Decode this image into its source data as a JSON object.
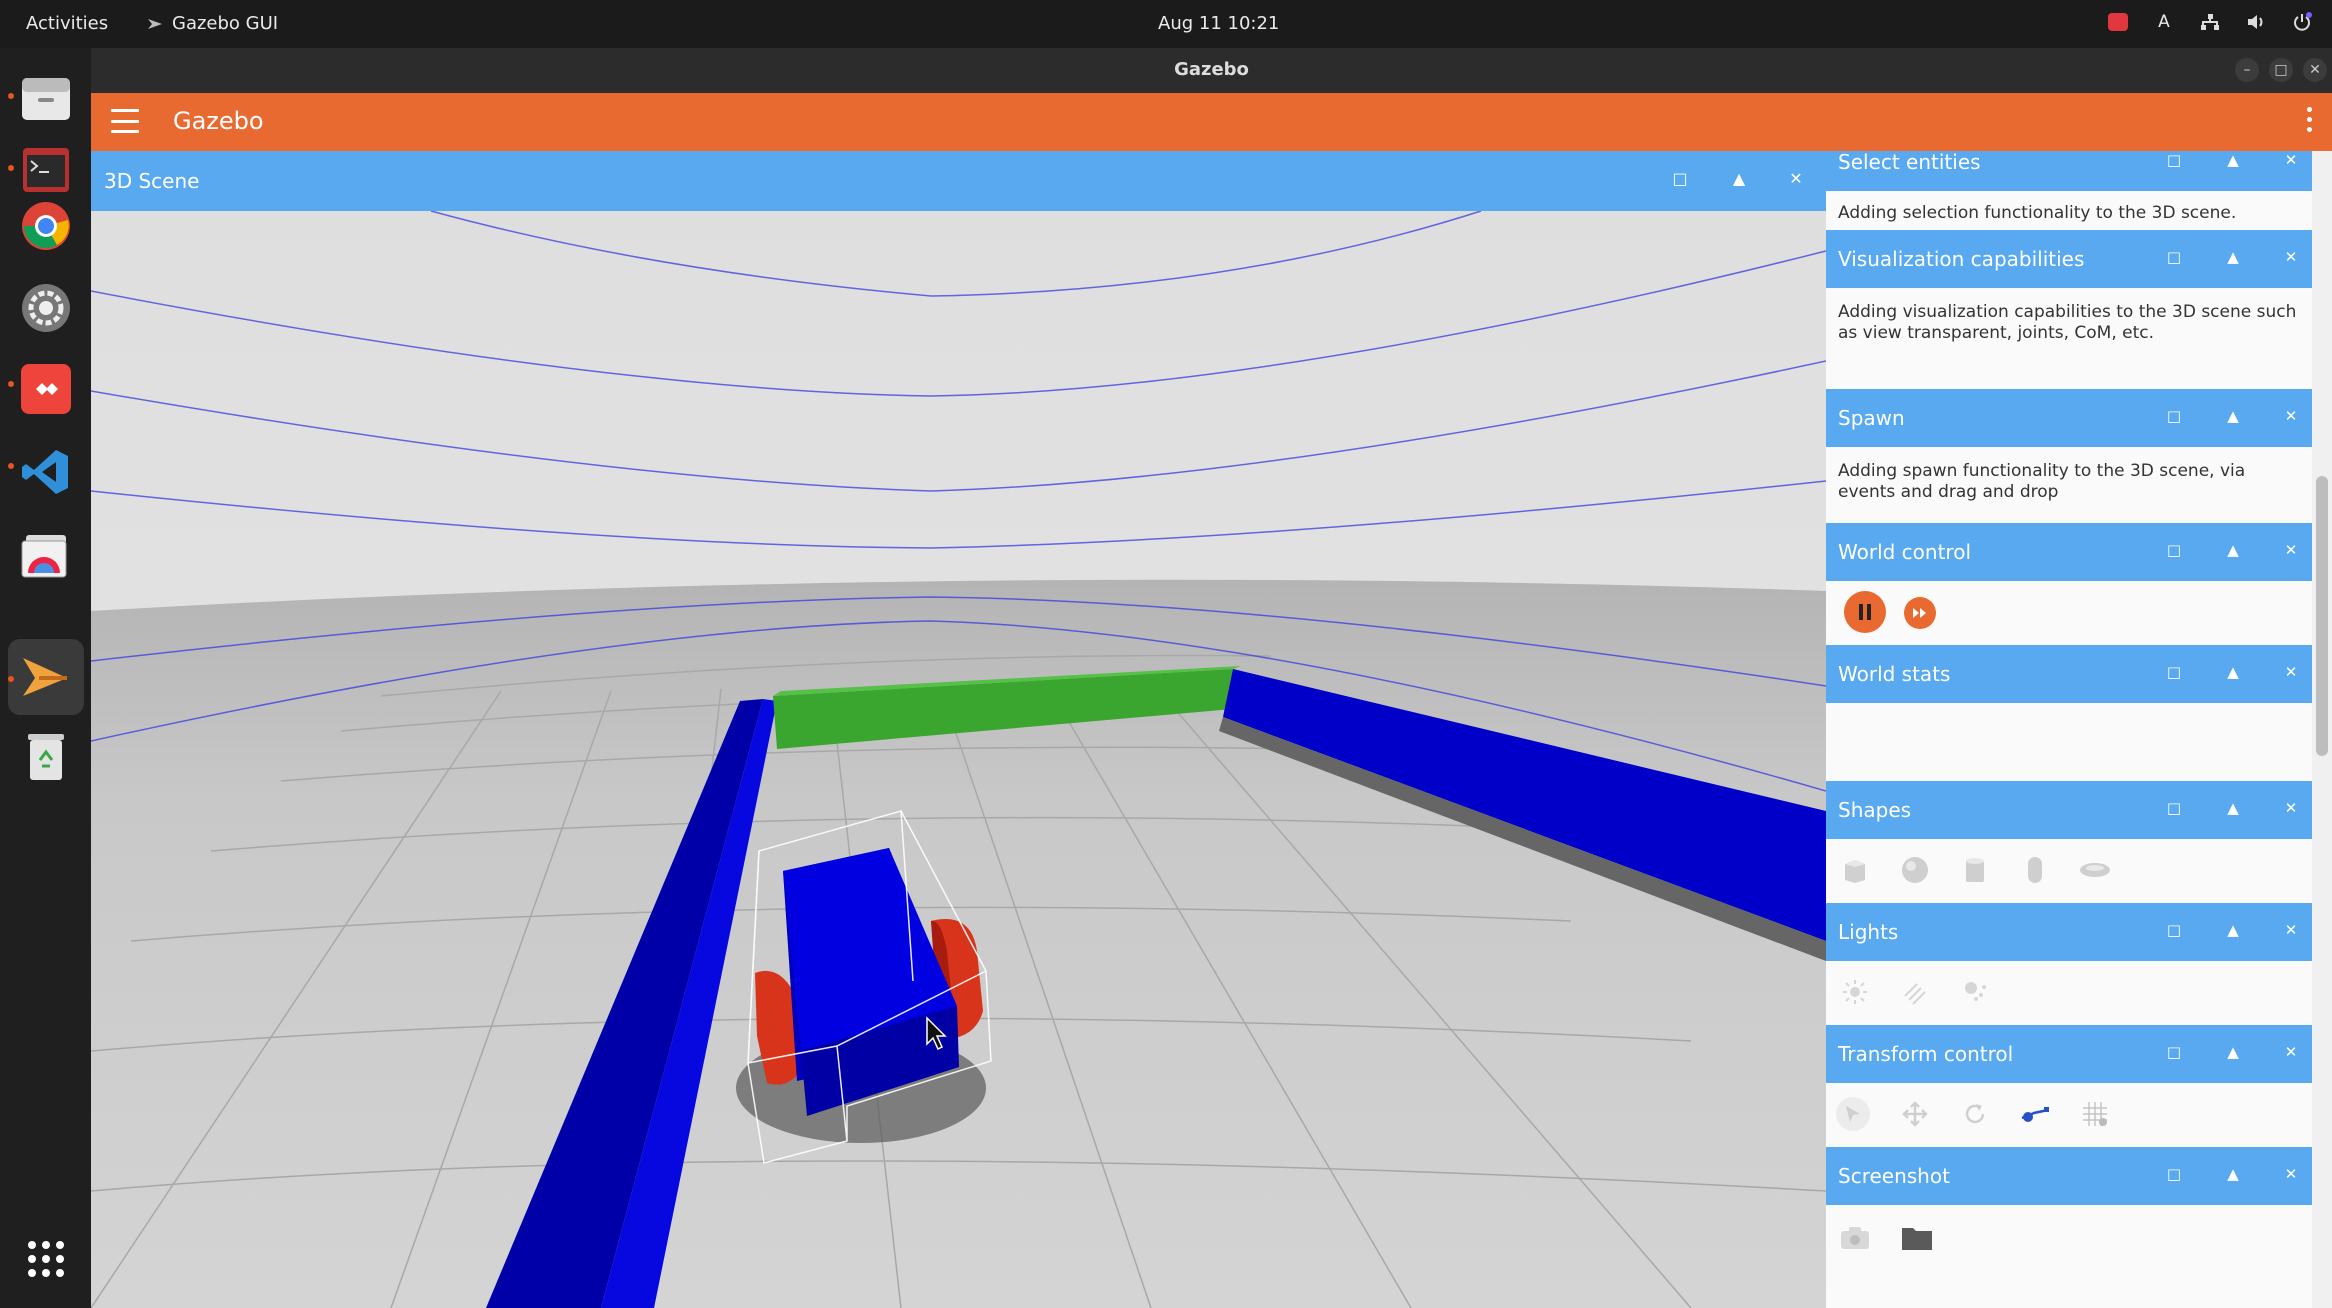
{
  "topbar": {
    "activities": "Activities",
    "app_name": "Gazebo GUI",
    "clock": "Aug 11  10:21",
    "keyboard_layout": "A"
  },
  "dock": {
    "items": [
      "files",
      "terminal",
      "chrome",
      "settings",
      "anydesk",
      "vscode",
      "image-viewer",
      "gazebo",
      "trash",
      "app-grid"
    ]
  },
  "window": {
    "title": "Gazebo",
    "app_title": "Gazebo"
  },
  "scene": {
    "title": "3D Scene"
  },
  "panel": {
    "select_entities": {
      "title": "Select entities",
      "description": "Adding selection functionality to the 3D scene."
    },
    "visualization": {
      "title": "Visualization capabilities",
      "description": "Adding visualization capabilities to the 3D scene such as view transparent, joints, CoM, etc."
    },
    "spawn": {
      "title": "Spawn",
      "description": "Adding spawn functionality to the 3D scene, via events and drag and drop"
    },
    "world_control": {
      "title": "World control"
    },
    "world_stats": {
      "title": "World stats"
    },
    "shapes": {
      "title": "Shapes",
      "tools": [
        "box",
        "sphere",
        "cylinder",
        "capsule",
        "ellipsoid"
      ]
    },
    "lights": {
      "title": "Lights",
      "tools": [
        "point-light",
        "directional-light",
        "spot-light"
      ]
    },
    "transform": {
      "title": "Transform control",
      "tools": [
        "select",
        "translate",
        "rotate",
        "scale",
        "snap-grid"
      ]
    },
    "screenshot": {
      "title": "Screenshot",
      "tools": [
        "camera",
        "folder"
      ]
    }
  },
  "colors": {
    "accent_orange": "#e96a30",
    "header_blue": "#58a9ef",
    "wall_blue": "#0000cc",
    "wall_green": "#3aa62f",
    "wheel_red": "#d8341c"
  }
}
